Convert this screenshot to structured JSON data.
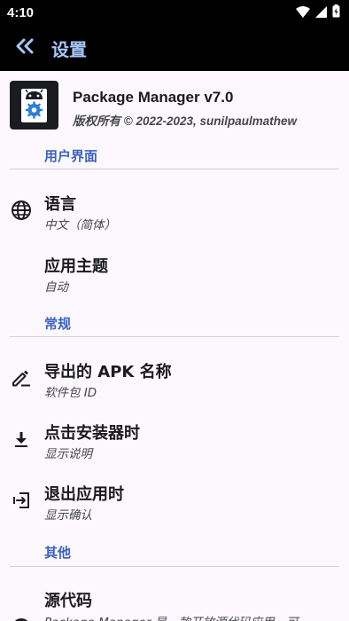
{
  "status_bar": {
    "time": "4:10",
    "icons": [
      "wifi-icon",
      "signal-icon",
      "battery-icon"
    ]
  },
  "app_bar": {
    "back_icon": "double-chevron-left-icon",
    "title": "设置"
  },
  "about": {
    "name": "Package Manager v7.0",
    "copyright": "版权所有 © 2022-2023, sunilpaulmathew"
  },
  "sections": {
    "ui": "用户界面",
    "general": "常规",
    "other": "其他"
  },
  "items": {
    "language": {
      "title": "语言",
      "summary": "中文（简体）",
      "icon": "globe-icon"
    },
    "theme": {
      "title": "应用主题",
      "summary": "自动",
      "icon": "moon-icon"
    },
    "export_name": {
      "title": "导出的 APK 名称",
      "summary": "软件包 ID",
      "icon": "edit-icon"
    },
    "installer_click": {
      "title": "点击安装器时",
      "summary": "显示说明",
      "icon": "download-icon"
    },
    "exit_app": {
      "title": "退出应用时",
      "summary": "显示确认",
      "icon": "exit-icon"
    },
    "source_code": {
      "title": "源代码",
      "summary": "Package Manager 是一款开放源代码应用，可",
      "icon": "github-icon"
    }
  },
  "colors": {
    "accent": "#3a62c4",
    "toolbar_title": "#a8c7fa",
    "background": "#fcf8fd"
  }
}
